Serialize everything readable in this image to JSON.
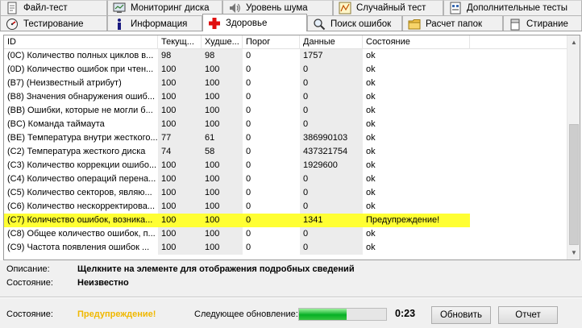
{
  "tabs_row1": [
    {
      "label": "Файл-тест",
      "icon": "file-test-icon"
    },
    {
      "label": "Мониторинг диска",
      "icon": "disk-monitor-icon"
    },
    {
      "label": "Уровень шума",
      "icon": "noise-level-icon"
    },
    {
      "label": "Случайный тест",
      "icon": "random-test-icon"
    },
    {
      "label": "Дополнительные тесты",
      "icon": "extra-tests-icon"
    }
  ],
  "tabs_row2": [
    {
      "label": "Тестирование",
      "icon": "testing-icon"
    },
    {
      "label": "Информация",
      "icon": "info-icon"
    },
    {
      "label": "Здоровье",
      "icon": "health-cross-icon",
      "active": true
    },
    {
      "label": "Поиск ошибок",
      "icon": "error-scan-icon"
    },
    {
      "label": "Расчет папок",
      "icon": "folder-icon"
    },
    {
      "label": "Стирание",
      "icon": "erase-icon"
    }
  ],
  "table": {
    "headers": [
      "ID",
      "Текущ...",
      "Худше...",
      "Порог",
      "Данные",
      "Состояние"
    ],
    "rows": [
      [
        "(0C) Количество полных циклов в...",
        "98",
        "98",
        "0",
        "1757",
        "ok"
      ],
      [
        "(0D) Количество ошибок при чтен...",
        "100",
        "100",
        "0",
        "0",
        "ok"
      ],
      [
        "(B7) (Неизвестный атрибут)",
        "100",
        "100",
        "0",
        "0",
        "ok"
      ],
      [
        "(B8) Значения обнаружения ошиб...",
        "100",
        "100",
        "0",
        "0",
        "ok"
      ],
      [
        "(BB) Ошибки, которые не могли б...",
        "100",
        "100",
        "0",
        "0",
        "ok"
      ],
      [
        "(BC) Команда таймаута",
        "100",
        "100",
        "0",
        "0",
        "ok"
      ],
      [
        "(BE) Температура внутри жесткого...",
        "77",
        "61",
        "0",
        "386990103",
        "ok"
      ],
      [
        "(C2) Температура жесткого диска",
        "74",
        "58",
        "0",
        "437321754",
        "ok"
      ],
      [
        "(C3) Количество коррекции ошибо...",
        "100",
        "100",
        "0",
        "1929600",
        "ok"
      ],
      [
        "(C4) Количество операций перена...",
        "100",
        "100",
        "0",
        "0",
        "ok"
      ],
      [
        "(C5) Количество секторов, являю...",
        "100",
        "100",
        "0",
        "0",
        "ok"
      ],
      [
        "(C6) Количество нескорректирова...",
        "100",
        "100",
        "0",
        "0",
        "ok"
      ],
      [
        "(C7) Количество ошибок, возника...",
        "100",
        "100",
        "0",
        "1341",
        "Предупреждение!"
      ],
      [
        "(C8) Общее количество ошибок, п...",
        "100",
        "100",
        "0",
        "0",
        "ok"
      ],
      [
        "(C9)  Частота появления ошибок ...",
        "100",
        "100",
        "0",
        "0",
        "ok"
      ]
    ],
    "warning_row_index": 12,
    "warning_color": "#ffff33"
  },
  "details": {
    "desc_label": "Описание:",
    "desc_value": "Щелкните на элементе для отображения подробных сведений",
    "state_label": "Состояние:",
    "state_value": "Неизвестно"
  },
  "footer": {
    "status_label": "Состояние:",
    "status_value": "Предупреждение!",
    "status_color": "#f0b800",
    "next_update_label": "Следующее обновление:",
    "progress_fraction": 0.55,
    "timer": "0:23",
    "refresh_label": "Обновить",
    "report_label": "Отчет"
  }
}
